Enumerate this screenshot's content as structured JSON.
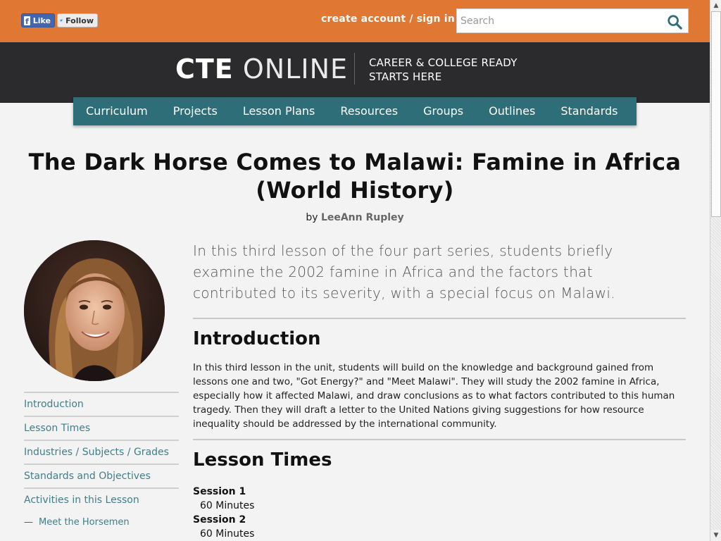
{
  "social": {
    "like_label": "Like",
    "follow_label": "Follow"
  },
  "header": {
    "account_link": "create account / sign in",
    "search_placeholder": "Search",
    "logo_bold": "CTE",
    "logo_light": "ONLINE",
    "tagline_line1": "CAREER & COLLEGE READY",
    "tagline_line2": "STARTS HERE"
  },
  "nav": {
    "items": [
      "Curriculum",
      "Projects",
      "Lesson Plans",
      "Resources",
      "Groups",
      "Outlines",
      "Standards"
    ]
  },
  "page": {
    "title_line1": "The Dark Horse Comes to Malawi: Famine in Africa",
    "title_line2": "(World History)",
    "byline_prefix": "by",
    "author": "LeeAnn Rupley",
    "lede": "In this third lesson of the four part series, students briefly examine the 2002 famine in Africa and the factors that contributed to its severity, with a special focus on Malawi."
  },
  "sidebar": {
    "items": [
      "Introduction",
      "Lesson Times",
      "Industries / Subjects / Grades",
      "Standards and Objectives",
      "Activities in this Lesson"
    ],
    "sub_items": [
      "Meet the Horsemen"
    ],
    "sub_marker": "—"
  },
  "sections": {
    "intro_heading": "Introduction",
    "intro_text": "In this third lesson in the unit, students will build on the knowledge and background gained from lessons one and two, \"Got Energy?\" and \"Meet Malawi\". They will study the 2002 famine in Africa, especially how it affected Malawi, and draw conclusions as to what factors contributed to this human tragedy. Then they will draft a letter to the United Nations giving suggestions for how resource inequality should be addressed by the international community.",
    "times_heading": "Lesson Times",
    "sessions": [
      {
        "title": "Session 1",
        "duration": "60 Minutes"
      },
      {
        "title": "Session 2",
        "duration": "60 Minutes"
      }
    ]
  },
  "colors": {
    "topbar": "#e07834",
    "header": "#2b2b2d",
    "nav": "#2e6e78",
    "link": "#3f7f8a"
  }
}
